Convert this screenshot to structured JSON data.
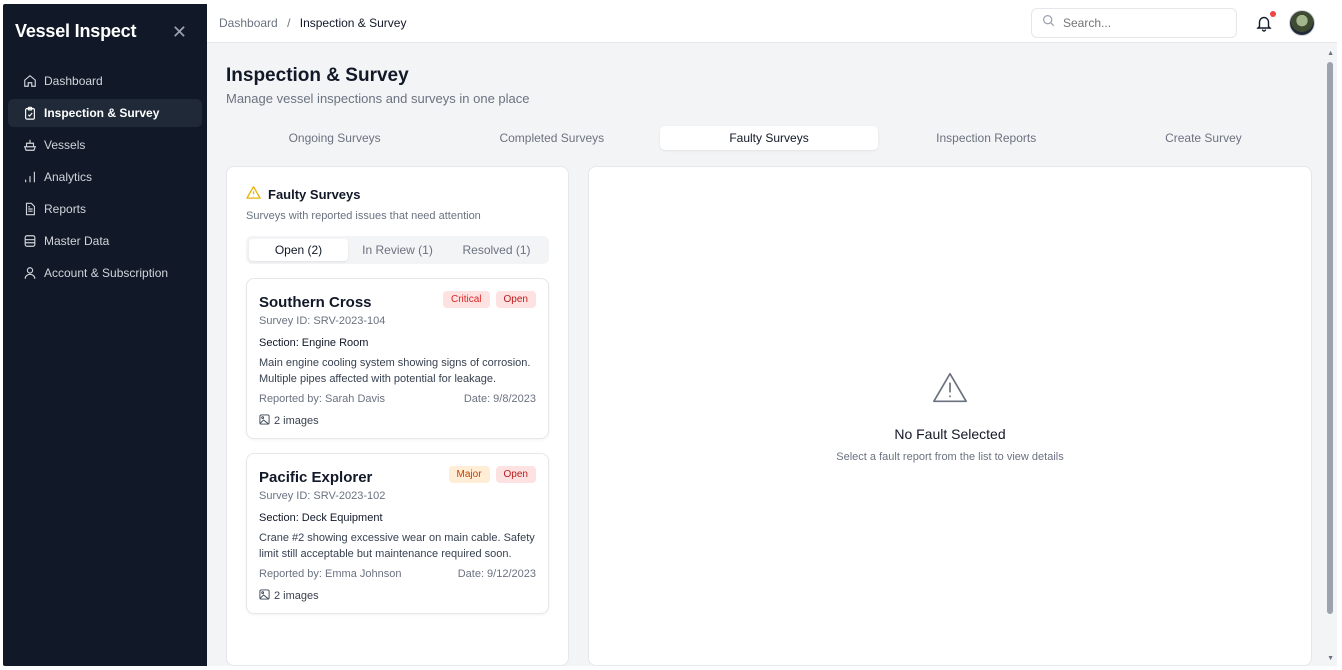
{
  "app": {
    "title": "Vessel Inspect",
    "close_icon": "close-icon"
  },
  "sidebar": {
    "items": [
      {
        "label": "Dashboard",
        "icon": "home-icon"
      },
      {
        "label": "Inspection & Survey",
        "icon": "clipboard-icon",
        "active": true
      },
      {
        "label": "Vessels",
        "icon": "ship-icon"
      },
      {
        "label": "Analytics",
        "icon": "bar-chart-icon"
      },
      {
        "label": "Reports",
        "icon": "file-text-icon"
      },
      {
        "label": "Master Data",
        "icon": "database-icon"
      },
      {
        "label": "Account & Subscription",
        "icon": "user-icon"
      }
    ]
  },
  "topbar": {
    "breadcrumb_root": "Dashboard",
    "breadcrumb_sep": "/",
    "breadcrumb_current": "Inspection & Survey",
    "search_placeholder": "Search...",
    "notification_color": "#ef4444"
  },
  "page": {
    "title": "Inspection & Survey",
    "subtitle": "Manage vessel inspections and surveys in one place"
  },
  "tabs": [
    {
      "label": "Ongoing Surveys"
    },
    {
      "label": "Completed Surveys"
    },
    {
      "label": "Faulty Surveys",
      "active": true
    },
    {
      "label": "Inspection Reports"
    },
    {
      "label": "Create Survey"
    }
  ],
  "faulty": {
    "title": "Faulty Surveys",
    "subtitle": "Surveys with reported issues that need attention",
    "subtabs": [
      {
        "label": "Open (2)",
        "active": true
      },
      {
        "label": "In Review (1)"
      },
      {
        "label": "Resolved (1)"
      }
    ],
    "cards": [
      {
        "vessel": "Southern Cross",
        "severity": "Critical",
        "status": "Open",
        "survey_id": "Survey ID: SRV-2023-104",
        "section": "Section: Engine Room",
        "description": "Main engine cooling system showing signs of corrosion. Multiple pipes affected with potential for leakage.",
        "reported_by": "Reported by: Sarah Davis",
        "date": "Date: 9/8/2023",
        "images": "2 images"
      },
      {
        "vessel": "Pacific Explorer",
        "severity": "Major",
        "status": "Open",
        "survey_id": "Survey ID: SRV-2023-102",
        "section": "Section: Deck Equipment",
        "description": "Crane #2 showing excessive wear on main cable. Safety limit still acceptable but maintenance required soon.",
        "reported_by": "Reported by: Emma Johnson",
        "date": "Date: 9/12/2023",
        "images": "2 images"
      }
    ]
  },
  "detail": {
    "empty_title": "No Fault Selected",
    "empty_subtitle": "Select a fault report from the list to view details"
  },
  "colors": {
    "sidebar_bg": "#111827",
    "warning": "#eab308",
    "critical_badge": "#dc2626",
    "major_badge": "#c2410c"
  }
}
